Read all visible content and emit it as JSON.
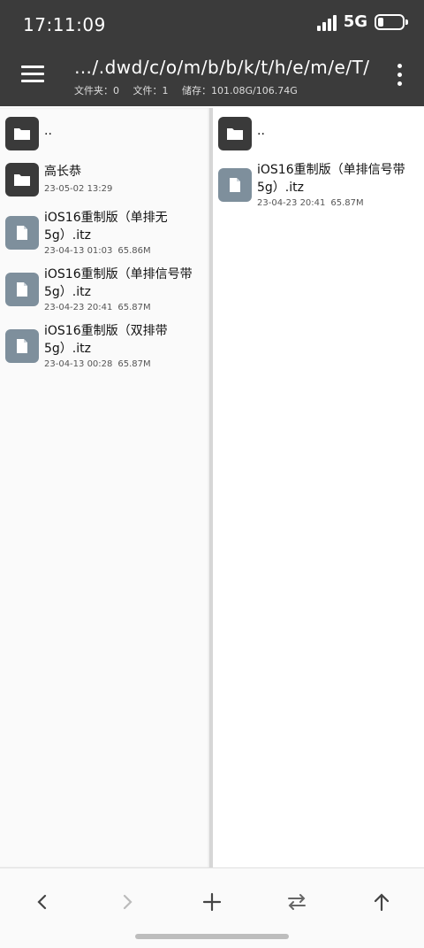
{
  "status": {
    "time": "17:11:09",
    "network": "5G"
  },
  "toolbar": {
    "path": "…/.dwd/c/o/m/b/b/k/t/h/e/m/e/T/",
    "folders": "文件夹：0",
    "files": "文件：1",
    "storage": "储存：101.08G/106.74G"
  },
  "left_pane": {
    "parent": "..",
    "folder_name": "高长恭",
    "folder_date": "23-05-02 13:29",
    "files": [
      {
        "name": "iOS16重制版（单排无5g）.itz",
        "date": "23-04-13 01:03",
        "size": "65.86M"
      },
      {
        "name": "iOS16重制版（单排信号带5g）.itz",
        "date": "23-04-23 20:41",
        "size": "65.87M"
      },
      {
        "name": "iOS16重制版（双排带5g）.itz",
        "date": "23-04-13 00:28",
        "size": "65.87M"
      }
    ]
  },
  "right_pane": {
    "parent": "..",
    "files": [
      {
        "name": "iOS16重制版（单排信号带5g）.itz",
        "date": "23-04-23 20:41",
        "size": "65.87M"
      }
    ]
  },
  "colors": {
    "toolbar_bg": "#3b3b3b",
    "folder_icon_bg": "#3a3a3a",
    "file_icon_bg": "#7e8f9c"
  }
}
